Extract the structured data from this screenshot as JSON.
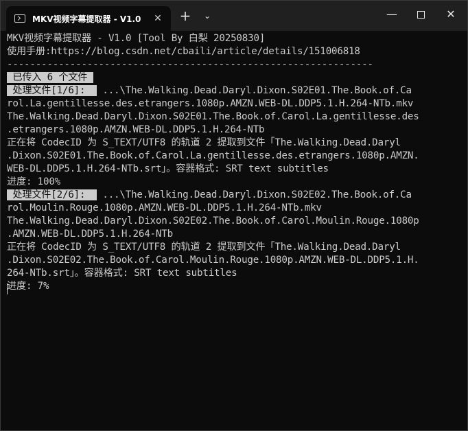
{
  "window": {
    "tab_title": "MKV视频字幕提取器 - V1.0",
    "tab_close": "✕",
    "new_tab": "+",
    "dropdown": "⌄",
    "minimize": "—",
    "close": "✕"
  },
  "console": {
    "line1": "MKV视频字幕提取器 - V1.0 [Tool By 白梨 20250830]",
    "line2": "使用手册:https://blog.csdn.net/cbaili/article/details/151006818",
    "line3": "----------------------------------------------------------------",
    "line4_hl": " 已传入 6 个文件 ",
    "line5_hl": " 处理文件[1/6]:  ",
    "line5_rest": " ...\\The.Walking.Dead.Daryl.Dixon.S02E01.The.Book.of.Ca",
    "line6": "rol.La.gentillesse.des.etrangers.1080p.AMZN.WEB-DL.DDP5.1.H.264-NTb.mkv",
    "line7": "The.Walking.Dead.Daryl.Dixon.S02E01.The.Book.of.Carol.La.gentillesse.des",
    "line8": ".etrangers.1080p.AMZN.WEB-DL.DDP5.1.H.264-NTb",
    "line9": "正在将 CodecID 为 S_TEXT/UTF8 的轨道 2 提取到文件「The.Walking.Dead.Daryl",
    "line10": ".Dixon.S02E01.The.Book.of.Carol.La.gentillesse.des.etrangers.1080p.AMZN.",
    "line11": "WEB-DL.DDP5.1.H.264-NTb.srt」。容器格式: SRT text subtitles",
    "line12": "进度: 100%",
    "line13_hl": " 处理文件[2/6]:  ",
    "line13_rest": " ...\\The.Walking.Dead.Daryl.Dixon.S02E02.The.Book.of.Ca",
    "line14": "rol.Moulin.Rouge.1080p.AMZN.WEB-DL.DDP5.1.H.264-NTb.mkv",
    "line15": "The.Walking.Dead.Daryl.Dixon.S02E02.The.Book.of.Carol.Moulin.Rouge.1080p",
    "line16": ".AMZN.WEB-DL.DDP5.1.H.264-NTb",
    "line17": "正在将 CodecID 为 S_TEXT/UTF8 的轨道 2 提取到文件「The.Walking.Dead.Daryl",
    "line18": ".Dixon.S02E02.The.Book.of.Carol.Moulin.Rouge.1080p.AMZN.WEB-DL.DDP5.1.H.",
    "line19": "264-NTb.srt」。容器格式: SRT text subtitles",
    "line20": "进度: 7%"
  },
  "colors": {
    "background": "#0c0c0c",
    "text": "#cccccc",
    "titlebar": "#202020",
    "highlight_bg": "#cccccc"
  }
}
